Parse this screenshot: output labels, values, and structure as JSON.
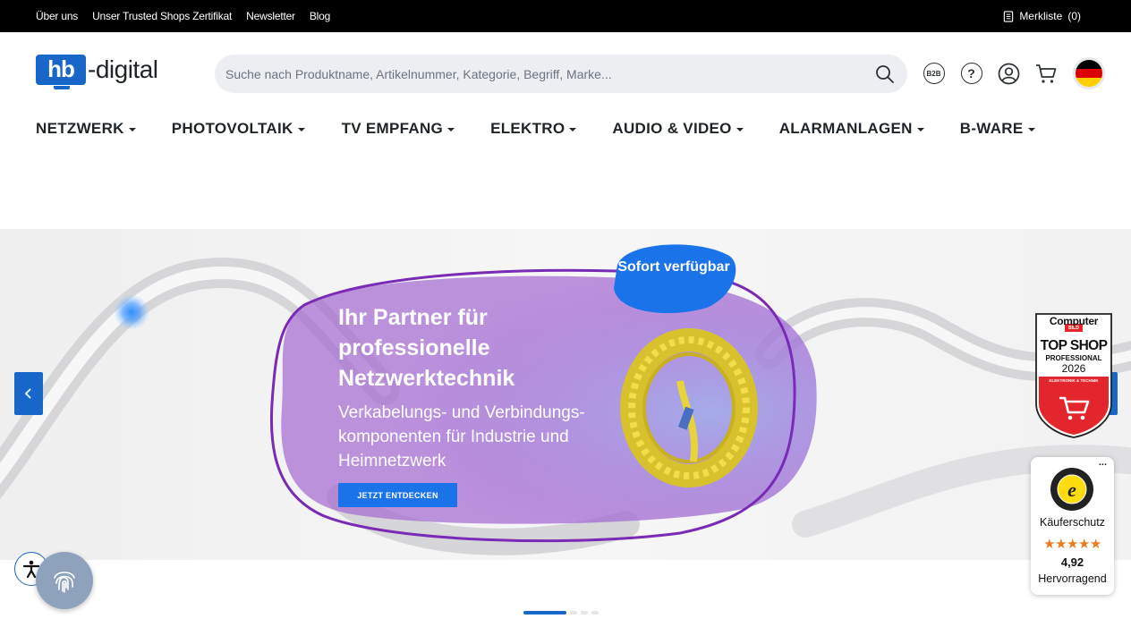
{
  "topbar": {
    "links": [
      "Über uns",
      "Unser Trusted Shops Zertifikat",
      "Newsletter",
      "Blog"
    ],
    "wishlist_label": "Merkliste",
    "wishlist_count": "(0)"
  },
  "header": {
    "logo_box": "hb",
    "logo_text": "-digital",
    "search_placeholder": "Suche nach Produktname, Artikelnummer, Kategorie, Begriff, Marke...",
    "icons": [
      "b2b-icon",
      "help-icon",
      "account-icon",
      "cart-icon",
      "language-flag-de"
    ],
    "b2b_label": "B2B",
    "help_label": "?"
  },
  "nav": {
    "items": [
      "NETZWERK",
      "PHOTOVOLTAIK",
      "TV EMPFANG",
      "ELEKTRO",
      "AUDIO & VIDEO",
      "ALARMANLAGEN",
      "B-WARE"
    ]
  },
  "hero": {
    "title": "Ihr Partner für professionelle Netzwerktechnik",
    "subtitle": "Verkabelungs- und Verbindungs-komponenten für Industrie und Heimnetzwerk",
    "cta": "JETZT ENTDECKEN",
    "badge": "Sofort verfügbar",
    "slides_total": 4,
    "slide_active": 1
  },
  "seal": {
    "brand": "Computer",
    "brand2": "BILD",
    "line1": "TOP SHOP",
    "line2": "PROFESSIONAL",
    "year": "2026",
    "category": "ELEKTRONIK & TECHNIK"
  },
  "trusted_shops": {
    "menu": "...",
    "label": "Käuferschutz",
    "stars": "★★★★★",
    "score": "4,92",
    "rating": "Hervorragend"
  },
  "colors": {
    "brand_blue": "#1766c8",
    "hero_purple": "#a56bd3",
    "star_orange": "#e97c1e"
  }
}
